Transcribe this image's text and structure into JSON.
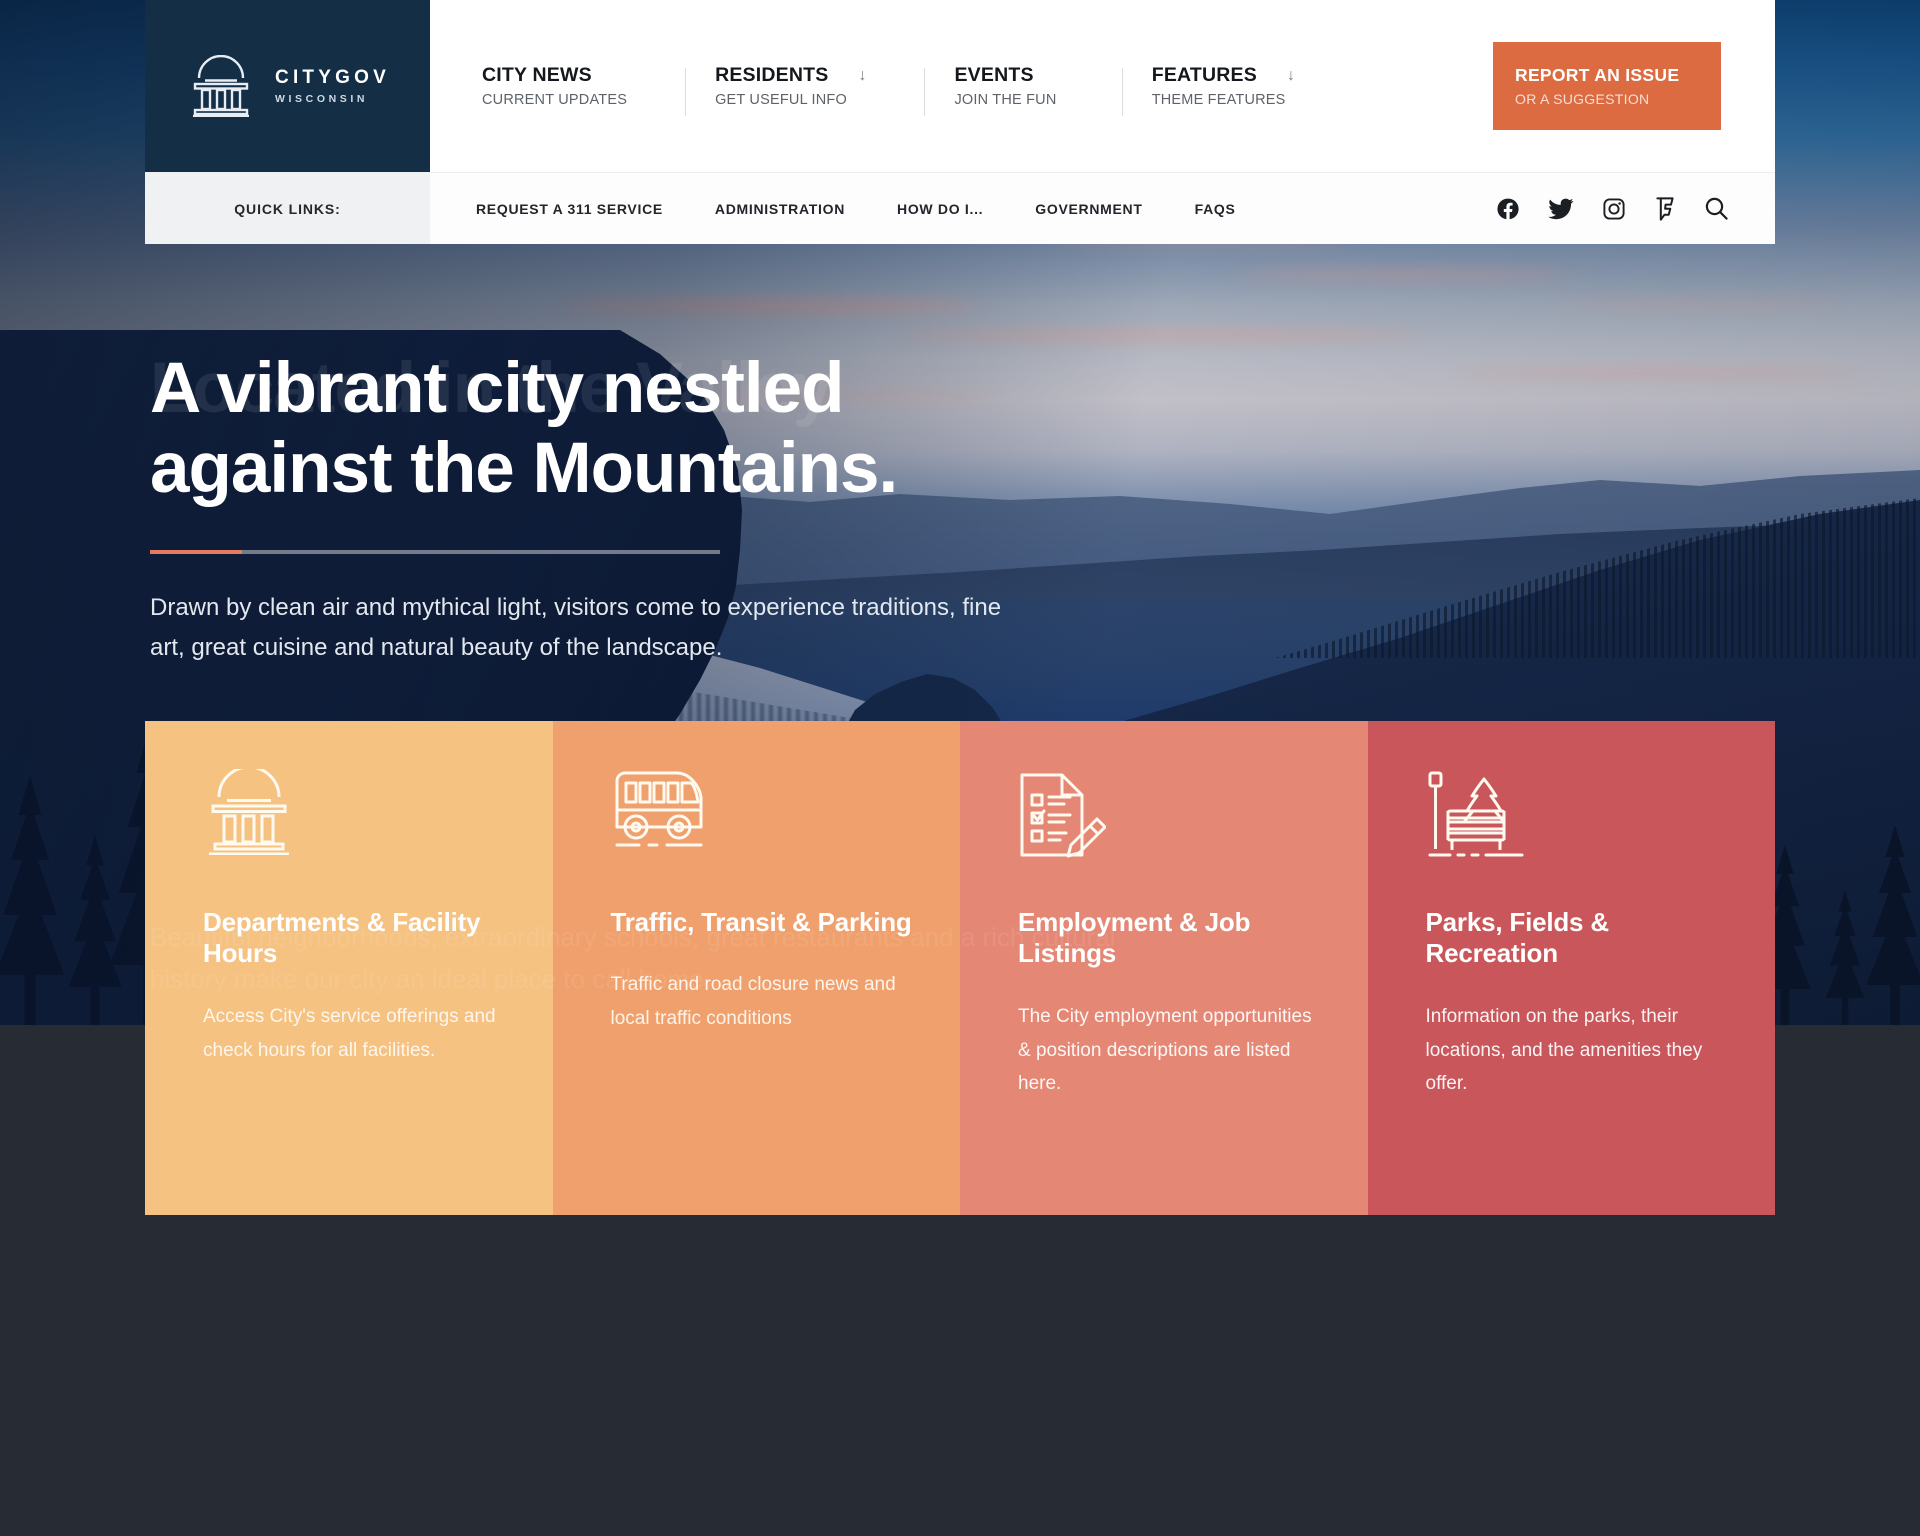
{
  "brand": {
    "name": "CITYGOV",
    "state": "WISCONSIN",
    "logo_icon": "capitol-building-icon",
    "logo_bg": "#132E45"
  },
  "nav": {
    "items": [
      {
        "title": "CITY NEWS",
        "sub": "CURRENT UPDATES",
        "arrow": ""
      },
      {
        "title": "RESIDENTS",
        "sub": "GET USEFUL INFO",
        "arrow": "↓"
      },
      {
        "title": "EVENTS",
        "sub": "JOIN THE FUN",
        "arrow": ""
      },
      {
        "title": "FEATURES",
        "sub": "THEME FEATURES",
        "arrow": "↓"
      }
    ]
  },
  "report_button": {
    "primary": "REPORT AN ISSUE",
    "secondary": "OR A SUGGESTION",
    "color": "#DD6B41"
  },
  "quicklinks": {
    "label": "QUICK LINKS:",
    "items": [
      "REQUEST A 311 SERVICE",
      "ADMINISTRATION",
      "HOW DO I...",
      "GOVERNMENT",
      "FAQS"
    ],
    "social": [
      "facebook-icon",
      "twitter-icon",
      "instagram-icon",
      "foursquare-icon",
      "search-icon"
    ]
  },
  "hero": {
    "headline": "A vibrant city nestled against the Mountains.",
    "ghost_headline": "Located in the Valley",
    "lede": "Drawn by clean air and mythical light, visitors come to experience traditions, fine art, great cuisine and natural beauty of the landscape.",
    "ghost_lede": "Beautiful neighborhoods, extraordinary schools, great restaurants and a rich cultural history make our city an ideal place to call home.",
    "accent_color": "#E37B5E"
  },
  "cards": [
    {
      "icon": "capitol-building-icon",
      "title": "Departments & Facility Hours",
      "desc": "Access City's service offerings and check hours for all facilities.",
      "bg": "#F5C282"
    },
    {
      "icon": "bus-icon",
      "title": "Traffic, Transit & Parking",
      "desc": "Traffic and road closure news and local traffic conditions",
      "bg": "#F0A06C"
    },
    {
      "icon": "checklist-pencil-icon",
      "title": "Employment & Job Listings",
      "desc": "The City employment opportunities & position descriptions are listed here.",
      "bg": "#E58775"
    },
    {
      "icon": "park-bench-icon",
      "title": "Parks, Fields & Recreation",
      "desc": "Information on the parks, their locations, and the amenities they offer.",
      "bg": "#C9565A"
    }
  ]
}
